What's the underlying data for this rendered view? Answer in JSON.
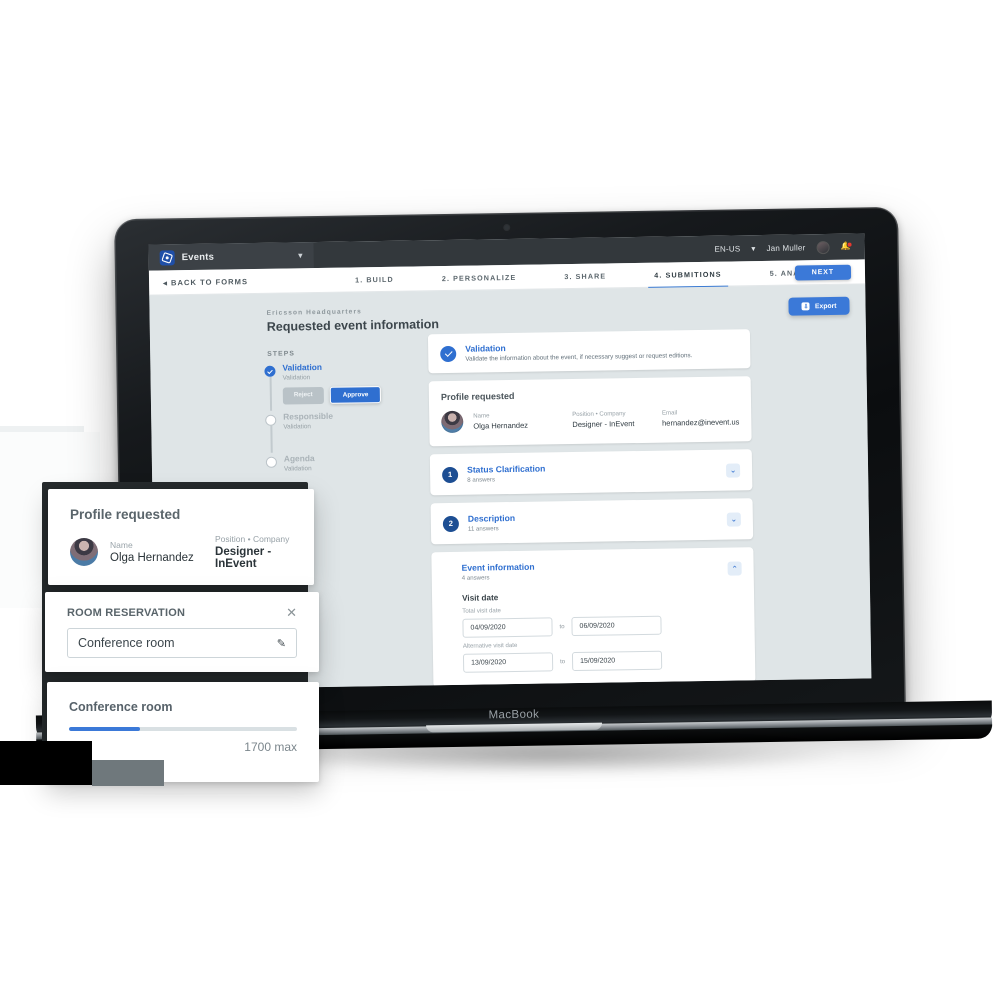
{
  "device": {
    "brand_label": "MacBook"
  },
  "topbar": {
    "app_name": "Events",
    "logo_icon": "inevent-logo-icon",
    "dropdown_icon": "chevron-down-icon",
    "locale": "EN-US",
    "locale_caret": "▾",
    "user_name": "Jan Muller",
    "avatar_icon": "user-avatar",
    "notifications_icon": "bell-icon"
  },
  "navbar": {
    "back_label": "◂ BACK TO FORMS",
    "tabs": [
      {
        "label": "1. BUILD",
        "active": false
      },
      {
        "label": "2. PERSONALIZE",
        "active": false
      },
      {
        "label": "3. SHARE",
        "active": false
      },
      {
        "label": "4. SUBMITIONS",
        "active": true
      },
      {
        "label": "5. ANALYZE",
        "active": false
      }
    ],
    "next_label": "NEXT"
  },
  "page": {
    "eyebrow": "Ericsson Headquarters",
    "title": "Requested event information",
    "export_label": "Export",
    "export_icon": "export-icon",
    "steps_heading": "STEPS"
  },
  "stepper": {
    "items": [
      {
        "title": "Validation",
        "subtitle": "Validation",
        "state": "done",
        "chevron": "⌃",
        "reject_label": "Reject",
        "approve_label": "Approve"
      },
      {
        "title": "Responsible",
        "subtitle": "Validation",
        "state": "pending",
        "chevron": "⌄"
      },
      {
        "title": "Agenda",
        "subtitle": "Validation",
        "state": "pending",
        "chevron": "⌄"
      }
    ]
  },
  "main": {
    "validation_card": {
      "title": "Validation",
      "description": "Validate the information about the event, if necessary suggest or request editions.",
      "check_icon": "check-circle-icon"
    },
    "profile_card": {
      "title": "Profile requested",
      "avatar_icon": "user-avatar",
      "fields": [
        {
          "label": "Name",
          "value": "Olga Hernandez"
        },
        {
          "label": "Position • Company",
          "value": "Designer - InEvent"
        },
        {
          "label": "Email",
          "value": "hernandez@inevent.us"
        }
      ]
    },
    "sections": [
      {
        "number": "1",
        "title": "Status Clarification",
        "answers": "8 answers",
        "expanded": false,
        "chevron": "⌄"
      },
      {
        "number": "2",
        "title": "Description",
        "answers": "11 answers",
        "expanded": false,
        "chevron": "⌄"
      }
    ],
    "event_information": {
      "title": "Event information",
      "answers": "4 answers",
      "expanded": true,
      "chevron": "⌃",
      "visit_date_title": "Visit date",
      "rows": [
        {
          "label": "Total visit date",
          "from": "04/09/2020",
          "separator": "to",
          "until": "06/09/2020"
        },
        {
          "label": "Alternative visit date",
          "from": "13/09/2020",
          "separator": "to",
          "until": "15/09/2020"
        }
      ]
    }
  },
  "overlay_cards": {
    "profile": {
      "title": "Profile requested",
      "avatar_icon": "user-avatar",
      "fields": [
        {
          "label": "Name",
          "value": "Olga Hernandez"
        },
        {
          "label": "Position • Company",
          "value": "Designer - InEvent"
        }
      ]
    },
    "room_reservation": {
      "title": "ROOM RESERVATION",
      "close_icon": "close-icon",
      "value": "Conference room",
      "edit_icon": "pencil-icon"
    },
    "capacity": {
      "title": "Conference room",
      "current": "529",
      "max_label": "1700 max",
      "percent": 31,
      "bar_color": "#3b79d8"
    }
  },
  "colors": {
    "accent_blue": "#2f6fd0",
    "button_blue": "#3b79d8",
    "deep_blue": "#1d4e93",
    "app_bg": "#dfe5e7",
    "topbar": "#33383c"
  }
}
